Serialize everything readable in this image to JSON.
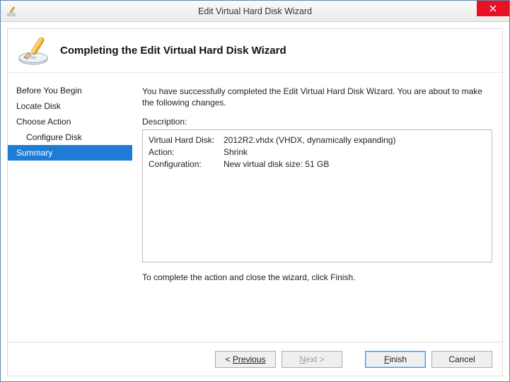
{
  "window": {
    "title": "Edit Virtual Hard Disk Wizard"
  },
  "header": {
    "title": "Completing the Edit Virtual Hard Disk Wizard"
  },
  "sidebar": {
    "steps": [
      {
        "label": "Before You Begin",
        "indent": false,
        "selected": false
      },
      {
        "label": "Locate Disk",
        "indent": false,
        "selected": false
      },
      {
        "label": "Choose Action",
        "indent": false,
        "selected": false
      },
      {
        "label": "Configure Disk",
        "indent": true,
        "selected": false
      },
      {
        "label": "Summary",
        "indent": false,
        "selected": true
      }
    ]
  },
  "main": {
    "intro": "You have successfully completed the Edit Virtual Hard Disk Wizard. You are about to make the following changes.",
    "desc_label": "Description:",
    "rows": [
      {
        "k": "Virtual Hard Disk:",
        "v": "2012R2.vhdx (VHDX, dynamically expanding)"
      },
      {
        "k": "Action:",
        "v": "Shrink"
      },
      {
        "k": "Configuration:",
        "v": "New virtual disk size: 51 GB"
      }
    ],
    "footer_hint": "To complete the action and close the wizard, click Finish."
  },
  "buttons": {
    "previous": "Previous",
    "next": "ext >",
    "finish": "inish",
    "cancel": "Cancel"
  }
}
